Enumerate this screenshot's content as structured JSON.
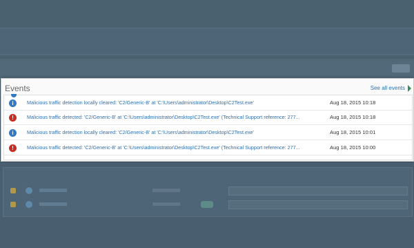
{
  "panel": {
    "title": "Events",
    "see_all_label": "See all events"
  },
  "events": [
    {
      "type": "info",
      "message": "Malicious traffic detection locally cleared: 'C2/Generic-B' at 'C:\\Users\\administrator\\Desktop\\C2Test.exe'",
      "time": "Aug 18, 2015 10:18"
    },
    {
      "type": "alert",
      "message": "Malicious traffic detected: 'C2/Generic-B' at 'C:\\Users\\administrator\\Desktop\\C2Test.exe' (Technical Support reference: 277...",
      "time": "Aug 18, 2015 10:18"
    },
    {
      "type": "info",
      "message": "Malicious traffic detection locally cleared: 'C2/Generic-B' at 'C:\\Users\\administrator\\Desktop\\C2Test.exe'",
      "time": "Aug 18, 2015 10:01"
    },
    {
      "type": "alert",
      "message": "Malicious traffic detected: 'C2/Generic-B' at 'C:\\Users\\administrator\\Desktop\\C2Test.exe' (Technical Support reference: 277...",
      "time": "Aug 18, 2015 10:00"
    }
  ],
  "icons": {
    "info": "info-icon",
    "alert": "alert-icon"
  },
  "colors": {
    "link": "#2a72b5",
    "info": "#3479c4",
    "alert": "#c62d24",
    "backdrop": "#4a6170"
  }
}
